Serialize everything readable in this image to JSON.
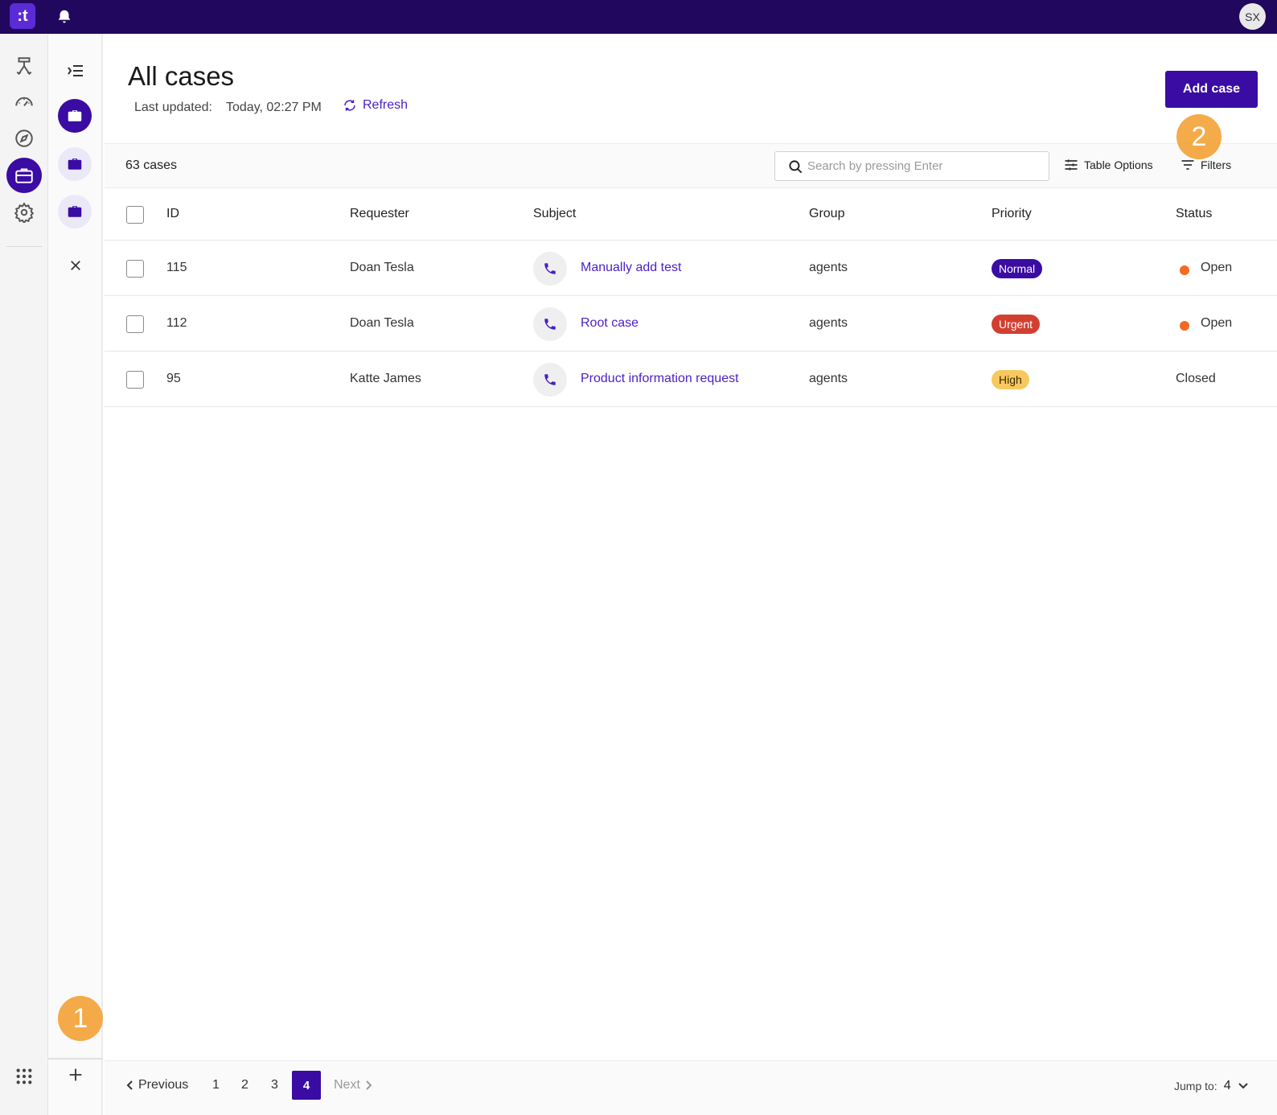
{
  "topbar": {
    "logo": ":t",
    "avatar": "SX"
  },
  "page": {
    "title": "All cases",
    "last_updated_label": "Last updated:",
    "last_updated_value": "Today, 02:27 PM",
    "refresh_label": "Refresh",
    "add_case_label": "Add case"
  },
  "toolbar": {
    "count": "63 cases",
    "search_placeholder": "Search by pressing Enter",
    "table_options_label": "Table Options",
    "filters_label": "Filters"
  },
  "table": {
    "columns": [
      "ID",
      "Requester",
      "Subject",
      "Group",
      "Priority",
      "Status"
    ],
    "rows": [
      {
        "id": "115",
        "requester": "Doan Tesla",
        "subject": "Manually add test",
        "group": "agents",
        "priority": "Normal",
        "priority_color": "#3a0ca3",
        "status": "Open",
        "status_dot": true
      },
      {
        "id": "112",
        "requester": "Doan Tesla",
        "subject": "Root case",
        "group": "agents",
        "priority": "Urgent",
        "priority_color": "#d23f31",
        "status": "Open",
        "status_dot": true
      },
      {
        "id": "95",
        "requester": "Katte James",
        "subject": "Product information request",
        "group": "agents",
        "priority": "High",
        "priority_color": "#f6c85f",
        "status": "Closed",
        "status_dot": false
      }
    ]
  },
  "pagination": {
    "previous": "Previous",
    "pages": [
      "1",
      "2",
      "3",
      "4"
    ],
    "current": "4",
    "next": "Next",
    "jump_label": "Jump to:",
    "jump_value": "4"
  },
  "annotations": {
    "marker_1": "1",
    "marker_2": "2"
  },
  "colors": {
    "brand": "#22075e",
    "accent": "#3a0ca3",
    "link": "#4b1fc6",
    "open_dot": "#f26a21",
    "marker": "#f4a43a"
  }
}
